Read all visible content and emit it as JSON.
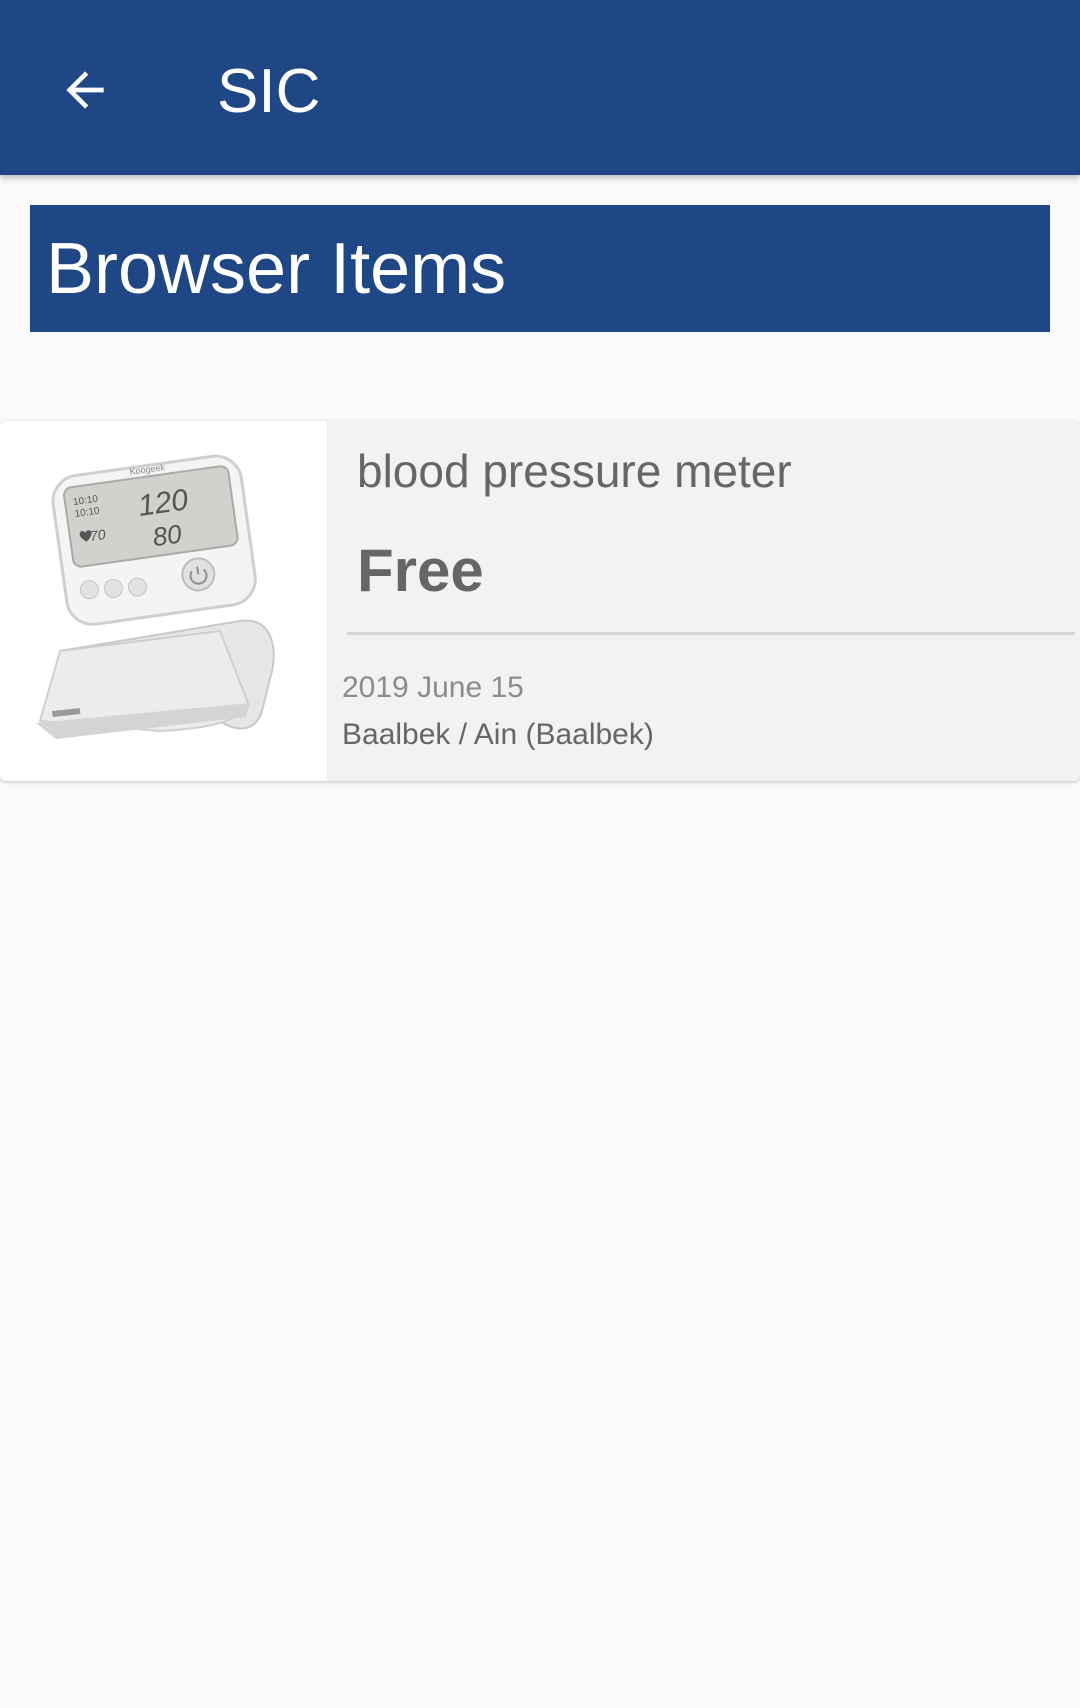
{
  "app_bar": {
    "title": "SIC",
    "back_icon": "arrow-left-icon",
    "background_color": "#204785"
  },
  "section": {
    "title": "Browser Items",
    "background_color": "#204785"
  },
  "items": [
    {
      "title": "blood pressure meter",
      "price": "Free",
      "date": "2019 June 15",
      "location": "Baalbek / Ain (Baalbek)",
      "image": {
        "brand": "Koogeek",
        "display_time_top": "10:10",
        "display_time_bottom": "10:10",
        "display_systolic": "120",
        "display_diastolic": "80",
        "display_pulse": "70"
      }
    }
  ]
}
